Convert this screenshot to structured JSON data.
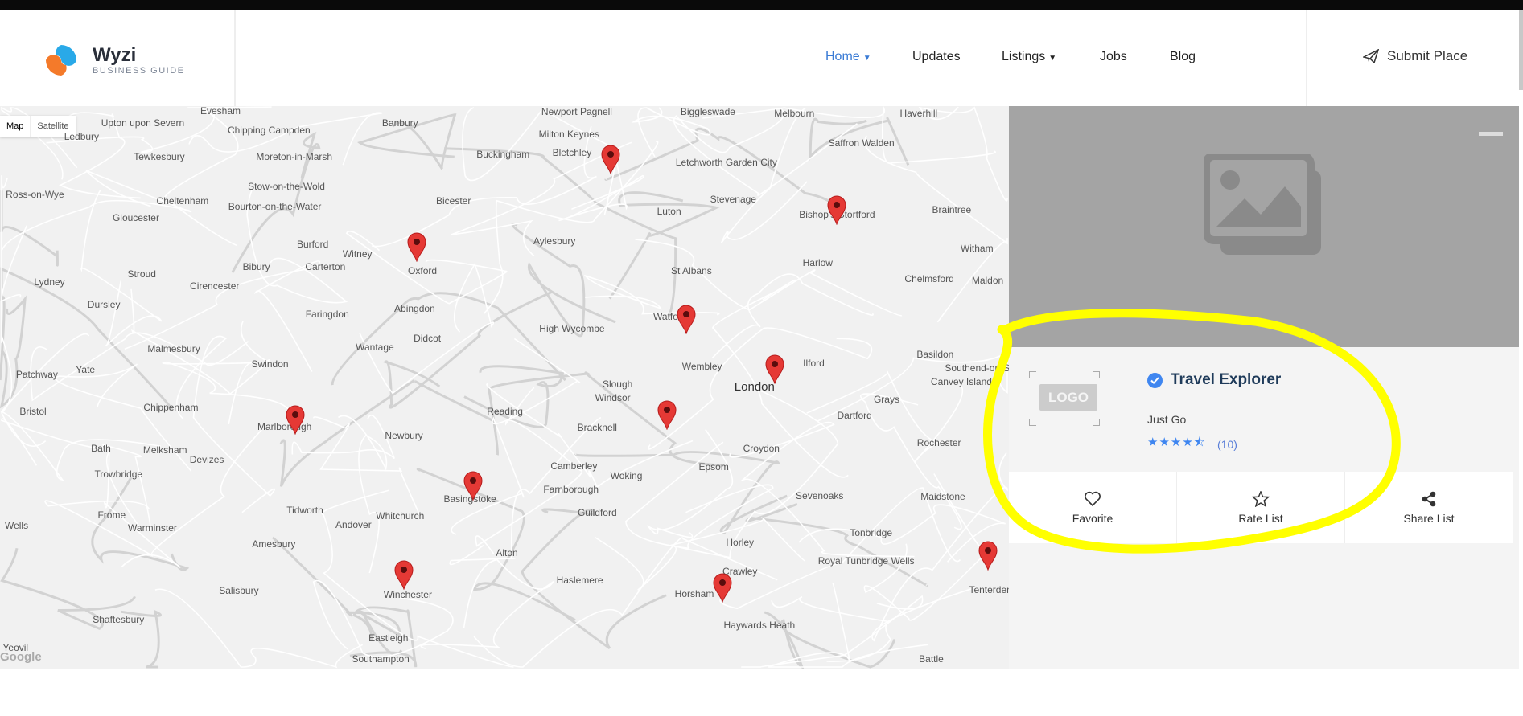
{
  "brand": {
    "name": "Wyzi",
    "tagline": "BUSINESS GUIDE"
  },
  "nav": [
    {
      "label": "Home",
      "dropdown": true,
      "active": true
    },
    {
      "label": "Updates"
    },
    {
      "label": "Listings",
      "dropdown": true
    },
    {
      "label": "Jobs"
    },
    {
      "label": "Blog"
    }
  ],
  "submit_label": "Submit Place",
  "map": {
    "type_buttons": {
      "map": "Map",
      "satellite": "Satellite"
    },
    "attribution": "Google",
    "places": [
      "Evesham",
      "Banbury",
      "Newport Pagnell",
      "Biggleswade",
      "Melbourn",
      "Haverhill",
      "Upton upon Severn",
      "Ledbury",
      "Chipping Campden",
      "Milton Keynes",
      "Saffron Walden",
      "Tewkesbury",
      "Moreton-in-Marsh",
      "Buckingham",
      "Bletchley",
      "Letchworth Garden City",
      "Stow-on-the-Wold",
      "Ross-on-Wye",
      "Cheltenham",
      "Bourton-on-the-Water",
      "Bicester",
      "Stevenage",
      "Luton",
      "Bishop's Stortford",
      "Braintree",
      "Gloucester",
      "Burford",
      "Witney",
      "Aylesbury",
      "Witham",
      "Bibury",
      "Carterton",
      "Oxford",
      "Stroud",
      "Cirencester",
      "Harlow",
      "St Albans",
      "Chelmsford",
      "Maldon",
      "Lydney",
      "Dursley",
      "Faringdon",
      "Abingdon",
      "Watford",
      "High Wycombe",
      "Wantage",
      "Didcot",
      "Malmesbury",
      "Swindon",
      "Wembley",
      "Ilford",
      "Basildon",
      "Southend-on-Sea",
      "Yate",
      "Patchway",
      "Slough",
      "Windsor",
      "London",
      "Canvey Island",
      "Bristol",
      "Chippenham",
      "Marlborough",
      "Reading",
      "Bracknell",
      "Grays",
      "Dartford",
      "Bath",
      "Newbury",
      "Melksham",
      "Devizes",
      "Croydon",
      "Rochester",
      "Trowbridge",
      "Camberley",
      "Woking",
      "Epsom",
      "Farnborough",
      "Basingstoke",
      "Sevenoaks",
      "Maidstone",
      "Tidworth",
      "Whitchurch",
      "Guildford",
      "Frome",
      "Andover",
      "Warminster",
      "Horley",
      "Tonbridge",
      "Amesbury",
      "Alton",
      "Royal Tunbridge Wells",
      "Crawley",
      "Salisbury",
      "Haslemere",
      "Winchester",
      "Horsham",
      "Tenterden",
      "Shaftesbury",
      "Haywards Heath",
      "Eastleigh",
      "Southampton",
      "Battle",
      "Wells",
      "Yeovil"
    ]
  },
  "listing": {
    "logo_text": "LOGO",
    "title": "Travel Explorer",
    "tagline": "Just Go",
    "rating": 4.5,
    "stars": "★★★★⯪",
    "review_count": "(10)",
    "actions": [
      {
        "label": "Favorite"
      },
      {
        "label": "Rate List"
      },
      {
        "label": "Share List"
      }
    ]
  },
  "colors": {
    "accent": "#3a7bd5",
    "marker": "#e53935",
    "annotation": "#ffff00",
    "hero": "#a4a4a4"
  }
}
